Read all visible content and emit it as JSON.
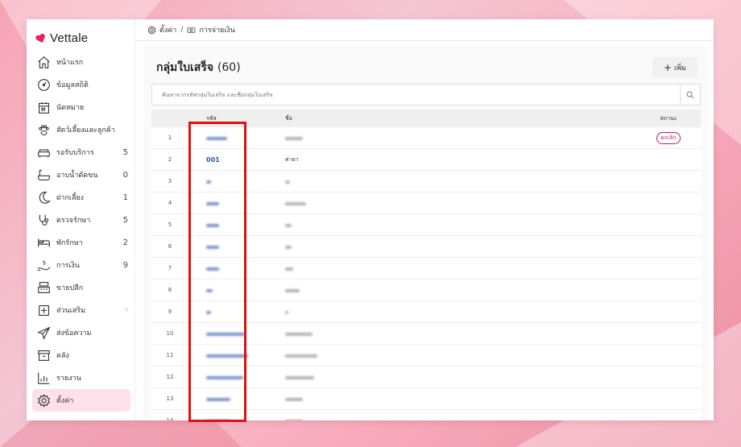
{
  "app": {
    "name": "Vettale"
  },
  "sidebar": {
    "items": [
      {
        "label": "หน้าแรก",
        "icon": "home-icon",
        "count": ""
      },
      {
        "label": "ข้อมูลสถิติ",
        "icon": "dashboard-icon",
        "count": ""
      },
      {
        "label": "นัดหมาย",
        "icon": "calendar-icon",
        "count": ""
      },
      {
        "label": "สัตว์เลี้ยงและลูกค้า",
        "icon": "paw-icon",
        "count": ""
      },
      {
        "label": "รอรับบริการ",
        "icon": "sofa-icon",
        "count": "5"
      },
      {
        "label": "อาบน้ำตัดขน",
        "icon": "bathtub-icon",
        "count": "0"
      },
      {
        "label": "ฝากเลี้ยง",
        "icon": "moon-icon",
        "count": "1"
      },
      {
        "label": "ตรวจรักษา",
        "icon": "stethoscope-icon",
        "count": "5"
      },
      {
        "label": "พักรักษา",
        "icon": "bed-icon",
        "count": "2"
      },
      {
        "label": "การเงิน",
        "icon": "money-hand-icon",
        "count": "9"
      },
      {
        "label": "ขายปลีก",
        "icon": "cash-register-icon",
        "count": ""
      },
      {
        "label": "ส่วนเสริม",
        "icon": "plus-square-icon",
        "count": ""
      },
      {
        "label": "ส่งข้อความ",
        "icon": "send-icon",
        "count": ""
      },
      {
        "label": "คลัง",
        "icon": "archive-icon",
        "count": ""
      },
      {
        "label": "รายงาน",
        "icon": "bar-chart-icon",
        "count": ""
      },
      {
        "label": "ตั้งค่า",
        "icon": "gear-icon",
        "count": ""
      }
    ]
  },
  "breadcrumb": {
    "settings": "ตั้งค่า",
    "separator": "/",
    "payment": "การจ่ายเงิน"
  },
  "page": {
    "title": "กลุ่มใบเสร็จ",
    "count": "(60)",
    "add_label": "เพิ่ม"
  },
  "search": {
    "placeholder": "ค้นหาจากรหัสกลุ่มใบเสร็จ และชื่อกลุ่มใบเสร็จ"
  },
  "table": {
    "headers": {
      "no": "",
      "code": "รหัส",
      "name": "ชื่อ",
      "status": "สถานะ"
    },
    "rows": [
      {
        "no": "1",
        "code": "",
        "name": "",
        "status": "ยกเลิก"
      },
      {
        "no": "2",
        "code": "001",
        "name": "ค่ายา",
        "status": ""
      },
      {
        "no": "3",
        "code": "",
        "name": "",
        "status": ""
      },
      {
        "no": "4",
        "code": "",
        "name": "",
        "status": ""
      },
      {
        "no": "5",
        "code": "",
        "name": "",
        "status": ""
      },
      {
        "no": "6",
        "code": "",
        "name": "",
        "status": ""
      },
      {
        "no": "7",
        "code": "",
        "name": "",
        "status": ""
      },
      {
        "no": "8",
        "code": "",
        "name": "",
        "status": ""
      },
      {
        "no": "9",
        "code": "",
        "name": "",
        "status": ""
      },
      {
        "no": "10",
        "code": "",
        "name": "",
        "status": ""
      },
      {
        "no": "11",
        "code": "",
        "name": "",
        "status": ""
      },
      {
        "no": "12",
        "code": "",
        "name": "",
        "status": ""
      },
      {
        "no": "13",
        "code": "",
        "name": "",
        "status": ""
      },
      {
        "no": "14",
        "code": "",
        "name": "",
        "status": ""
      }
    ]
  },
  "colors": {
    "brand": "#e91e63",
    "link": "#2b5aa5",
    "highlight": "#e01010",
    "active_bg": "#fde0ea"
  }
}
